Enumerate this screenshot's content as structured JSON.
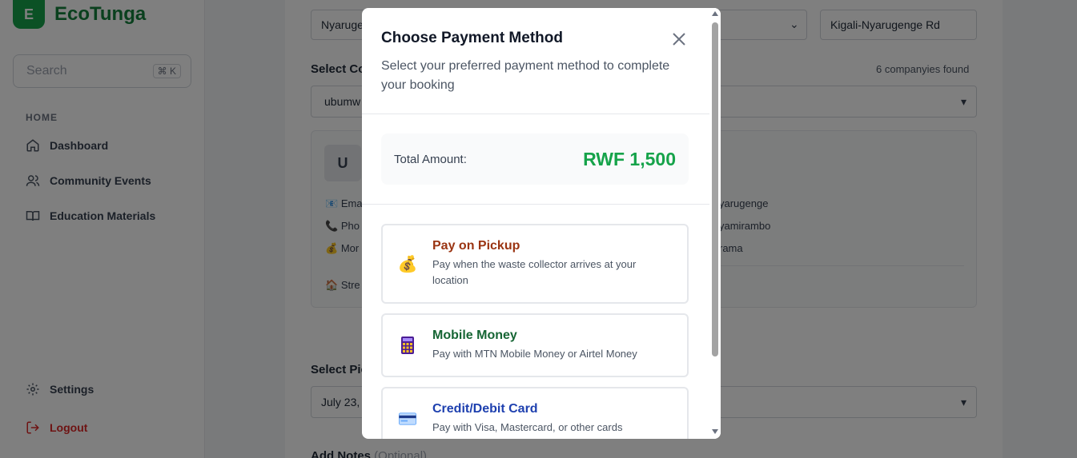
{
  "app": {
    "logo_letter": "E",
    "name": "EcoTunga",
    "brand_color": "#16a34a"
  },
  "sidebar": {
    "search_placeholder": "Search",
    "search_shortcut": "⌘ K",
    "section_label": "HOME",
    "items": [
      {
        "label": "Dashboard",
        "icon": "home-icon"
      },
      {
        "label": "Community Events",
        "icon": "users-icon"
      },
      {
        "label": "Education Materials",
        "icon": "book-icon"
      }
    ],
    "settings_label": "Settings",
    "logout_label": "Logout"
  },
  "form": {
    "district_value": "Nyaruge",
    "address_value": "Kigali-Nyarugenge Rd",
    "select_company_label": "Select Co",
    "companies_found": "6 companyies found",
    "company_value": "ubumw",
    "company_card": {
      "avatar_letter": "U",
      "email_prefix": "Ema",
      "phone_prefix": "Pho",
      "money_prefix": "Mor",
      "street_prefix": "Stre",
      "district_fragment": "yarugenge",
      "sector_fragment": "yamirambo",
      "cell_fragment": "rama"
    },
    "pickup_label": "Select Pic",
    "pickup_value": "July 23,",
    "notes_label": "Add Notes",
    "notes_optional": "(Optional)"
  },
  "modal": {
    "title": "Choose Payment Method",
    "subtitle": "Select your preferred payment method to complete your booking",
    "total_label": "Total Amount:",
    "total_value": "RWF 1,500",
    "options": [
      {
        "icon": "money-bag-icon",
        "title": "Pay on Pickup",
        "desc": "Pay when the waste collector arrives at your location",
        "color": "#9a3412"
      },
      {
        "icon": "mobile-phone-icon",
        "title": "Mobile Money",
        "desc": "Pay with MTN Mobile Money or Airtel Money",
        "color": "#166534"
      },
      {
        "icon": "credit-card-icon",
        "title": "Credit/Debit Card",
        "desc": "Pay with Visa, Mastercard, or other cards",
        "color": "#1e40af"
      }
    ]
  }
}
